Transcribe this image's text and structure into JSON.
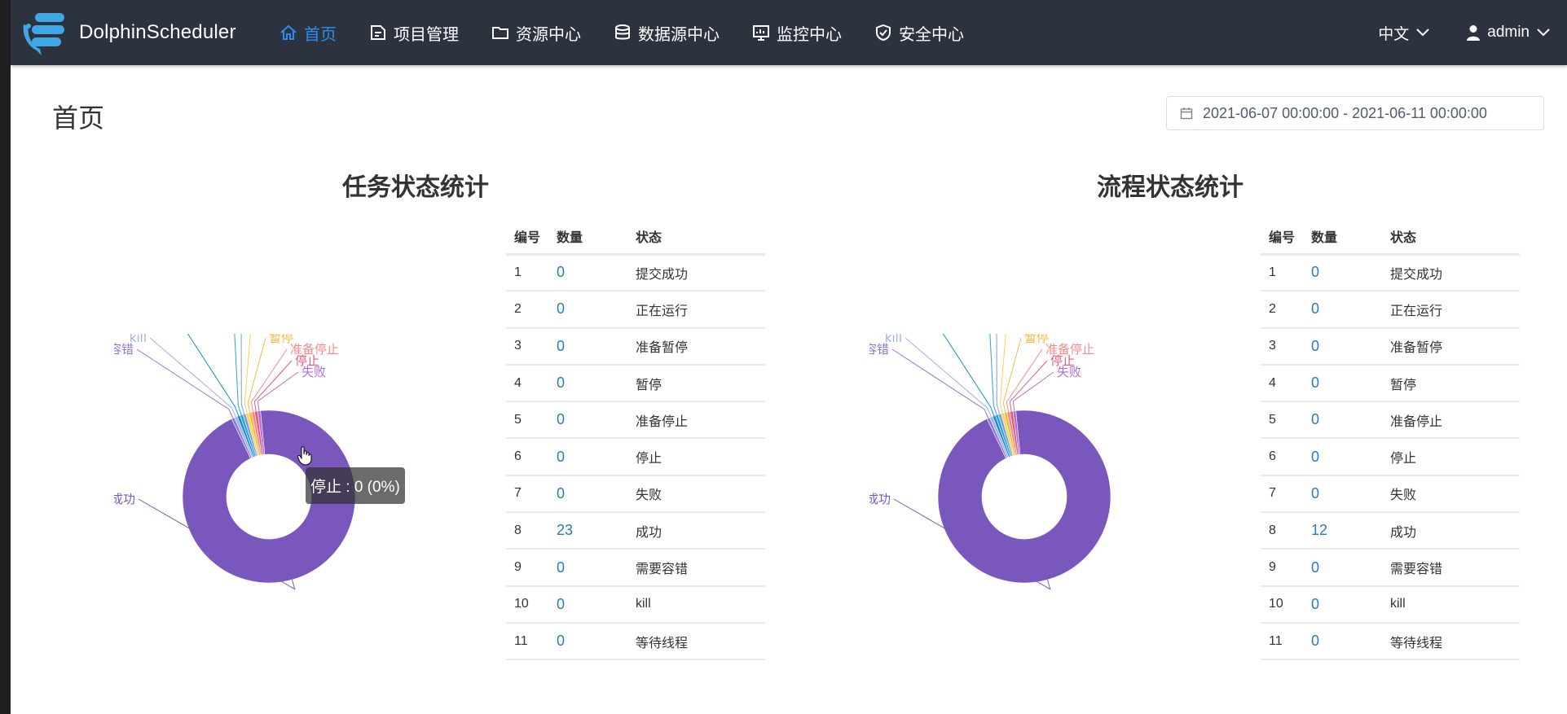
{
  "app": {
    "name": "DolphinScheduler"
  },
  "nav": {
    "items": [
      {
        "label": "首页",
        "icon": "home-icon",
        "active": true
      },
      {
        "label": "项目管理",
        "icon": "project-icon"
      },
      {
        "label": "资源中心",
        "icon": "folder-icon"
      },
      {
        "label": "数据源中心",
        "icon": "database-icon"
      },
      {
        "label": "监控中心",
        "icon": "monitor-icon"
      },
      {
        "label": "安全中心",
        "icon": "shield-icon"
      }
    ],
    "language": "中文",
    "user": "admin"
  },
  "page": {
    "title": "首页",
    "date_range": "2021-06-07 00:00:00 - 2021-06-11 00:00:00"
  },
  "task_stats": {
    "title": "任务状态统计",
    "columns": [
      "编号",
      "数量",
      "状态"
    ],
    "rows": [
      {
        "id": "1",
        "count": "0",
        "state": "提交成功"
      },
      {
        "id": "2",
        "count": "0",
        "state": "正在运行"
      },
      {
        "id": "3",
        "count": "0",
        "state": "准备暂停"
      },
      {
        "id": "4",
        "count": "0",
        "state": "暂停"
      },
      {
        "id": "5",
        "count": "0",
        "state": "准备停止"
      },
      {
        "id": "6",
        "count": "0",
        "state": "停止"
      },
      {
        "id": "7",
        "count": "0",
        "state": "失败"
      },
      {
        "id": "8",
        "count": "23",
        "state": "成功"
      },
      {
        "id": "9",
        "count": "0",
        "state": "需要容错"
      },
      {
        "id": "10",
        "count": "0",
        "state": "kill"
      },
      {
        "id": "11",
        "count": "0",
        "state": "等待线程"
      }
    ],
    "tooltip": "停止 : 0 (0%)"
  },
  "process_stats": {
    "title": "流程状态统计",
    "columns": [
      "编号",
      "数量",
      "状态"
    ],
    "rows": [
      {
        "id": "1",
        "count": "0",
        "state": "提交成功"
      },
      {
        "id": "2",
        "count": "0",
        "state": "正在运行"
      },
      {
        "id": "3",
        "count": "0",
        "state": "准备暂停"
      },
      {
        "id": "4",
        "count": "0",
        "state": "暂停"
      },
      {
        "id": "5",
        "count": "0",
        "state": "准备停止"
      },
      {
        "id": "6",
        "count": "0",
        "state": "停止"
      },
      {
        "id": "7",
        "count": "0",
        "state": "失败"
      },
      {
        "id": "8",
        "count": "12",
        "state": "成功"
      },
      {
        "id": "9",
        "count": "0",
        "state": "需要容错"
      },
      {
        "id": "10",
        "count": "0",
        "state": "kill"
      },
      {
        "id": "11",
        "count": "0",
        "state": "等待线程"
      }
    ]
  },
  "chart_data": [
    {
      "type": "pie",
      "title": "任务状态统计",
      "categories": [
        "提交成功",
        "正在运行",
        "准备暂停",
        "暂停",
        "准备停止",
        "停止",
        "失败",
        "成功",
        "需要容错",
        "kill",
        "等待线程"
      ],
      "values": [
        0,
        0,
        0,
        0,
        0,
        0,
        0,
        23,
        0,
        0,
        0
      ],
      "colors": [
        "#2ba4d8",
        "#7aa0d8",
        "#ffd05a",
        "#f5b944",
        "#f48a8a",
        "#e8587a",
        "#b070d0",
        "#7a57bd",
        "#8c78d8",
        "#a0b0e8",
        "#1a8ad0"
      ]
    },
    {
      "type": "pie",
      "title": "流程状态统计",
      "categories": [
        "提交成功",
        "正在运行",
        "准备暂停",
        "暂停",
        "准备停止",
        "停止",
        "失败",
        "成功",
        "需要容错",
        "kill",
        "等待线程"
      ],
      "values": [
        0,
        0,
        0,
        0,
        0,
        0,
        0,
        12,
        0,
        0,
        0
      ],
      "colors": [
        "#2ba4d8",
        "#7aa0d8",
        "#ffd05a",
        "#f5b944",
        "#f48a8a",
        "#e8587a",
        "#b070d0",
        "#7a57bd",
        "#8c78d8",
        "#a0b0e8",
        "#1a8ad0"
      ]
    }
  ]
}
